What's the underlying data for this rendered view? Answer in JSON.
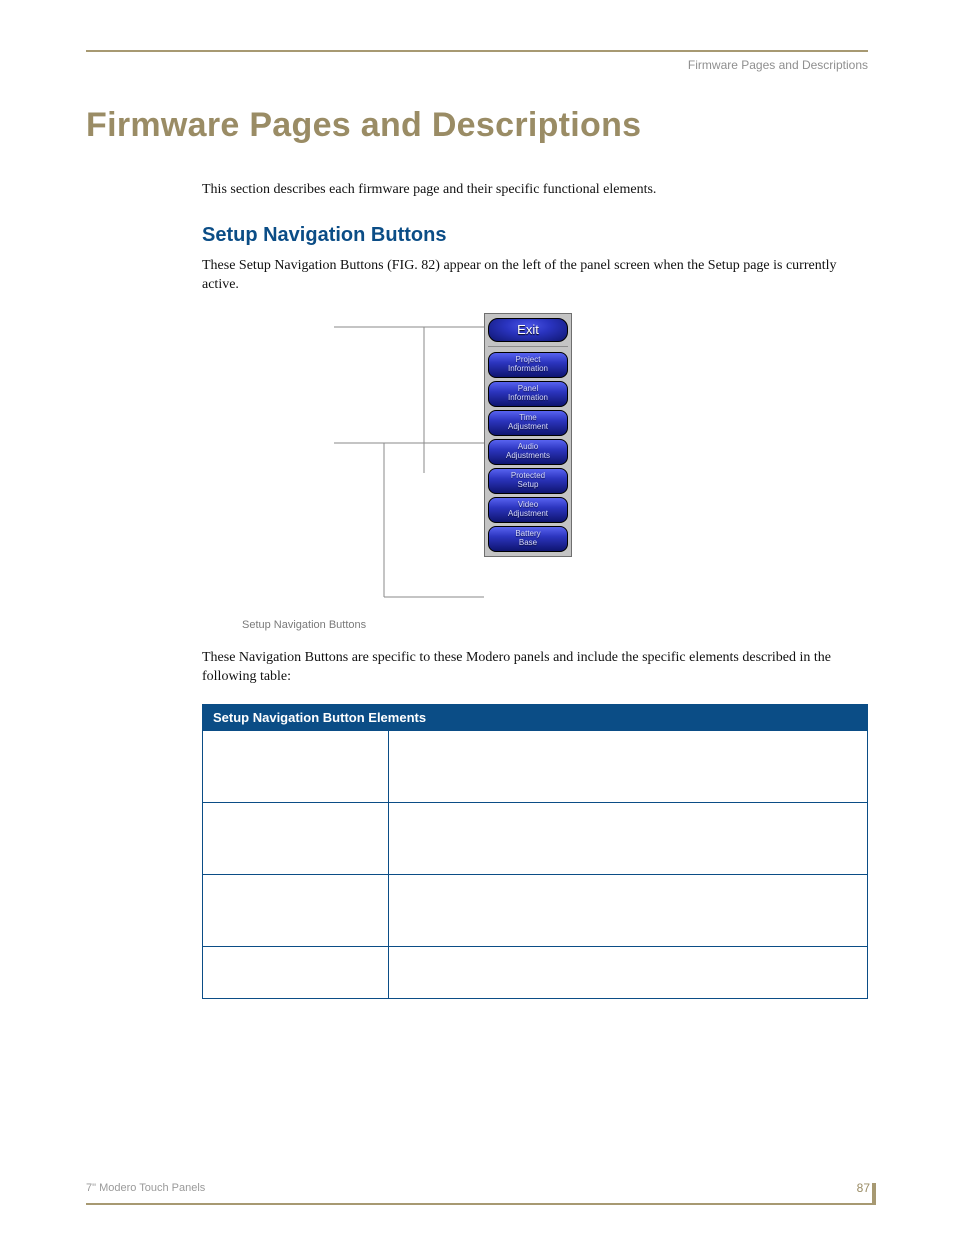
{
  "running_head": "Firmware Pages and Descriptions",
  "title": "Firmware Pages and Descriptions",
  "intro": "This section describes each firmware page and their specific functional elements.",
  "subhead": "Setup Navigation Buttons",
  "para1": "These Setup Navigation Buttons (FIG. 82) appear on the left of the panel screen when the Setup page is currently active.",
  "nav": {
    "exit": "Exit",
    "items": [
      "Project\nInformation",
      "Panel\nInformation",
      "Time\nAdjustment",
      "Audio\nAdjustments",
      "Protected\nSetup",
      "Video\nAdjustment",
      "Battery\nBase"
    ]
  },
  "fig_caption": "Setup Navigation Buttons",
  "para2": "These Navigation Buttons are specific to these Modero panels and include the specific elements described in the following table:",
  "table": {
    "header": "Setup Navigation Button Elements",
    "rows": [
      {
        "c1": "",
        "c2": ""
      },
      {
        "c1": "",
        "c2": ""
      },
      {
        "c1": "",
        "c2": ""
      },
      {
        "c1": "",
        "c2": ""
      }
    ]
  },
  "footer": {
    "left": "7\" Modero Touch Panels",
    "page": "87"
  }
}
